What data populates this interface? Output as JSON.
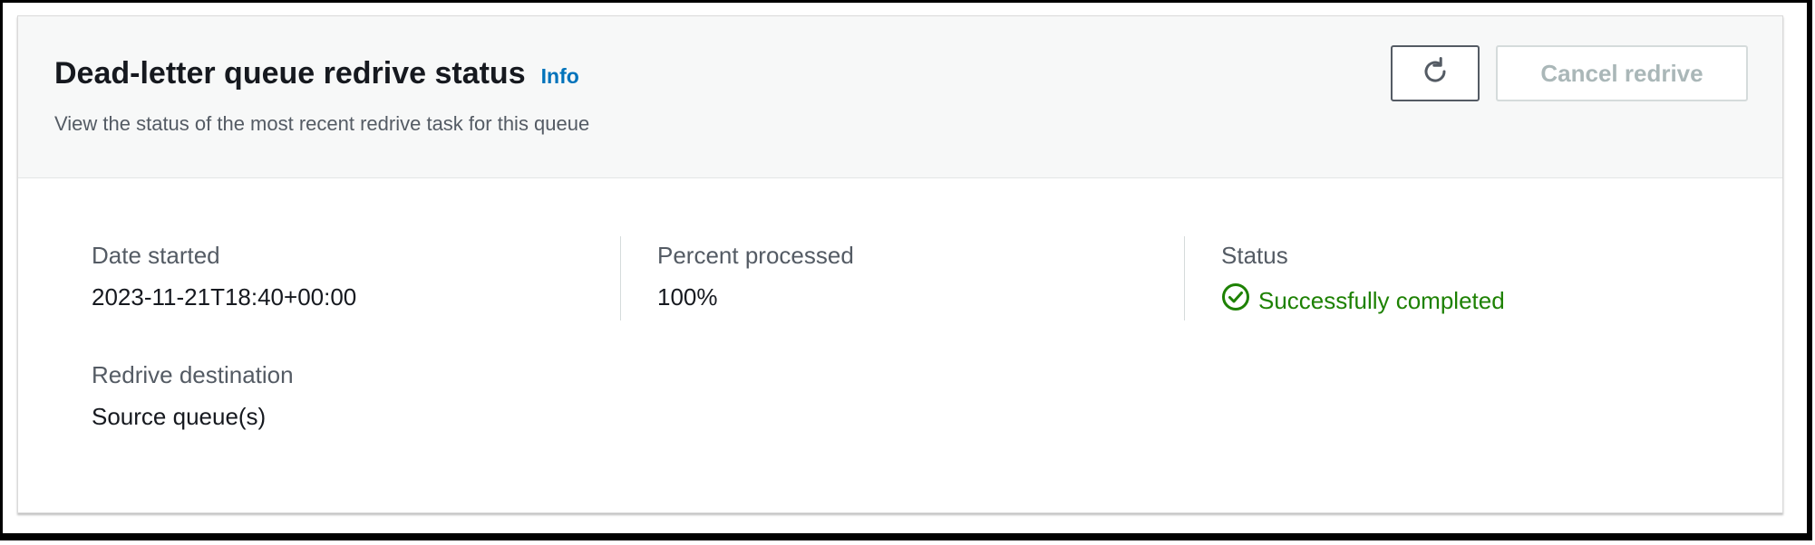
{
  "panel": {
    "title": "Dead-letter queue redrive status",
    "info_label": "Info",
    "subtitle": "View the status of the most recent redrive task for this queue"
  },
  "actions": {
    "refresh_icon": "refresh-icon",
    "cancel_label": "Cancel redrive"
  },
  "details": {
    "date_started": {
      "label": "Date started",
      "value": "2023-11-21T18:40+00:00"
    },
    "percent_processed": {
      "label": "Percent processed",
      "value": "100%"
    },
    "status": {
      "label": "Status",
      "value": "Successfully completed",
      "icon": "check-circle-icon",
      "color": "#1d8102"
    },
    "redrive_destination": {
      "label": "Redrive destination",
      "value": "Source queue(s)"
    }
  },
  "colors": {
    "link": "#0073bb",
    "success": "#1d8102",
    "disabled_text": "#aab7b8"
  }
}
